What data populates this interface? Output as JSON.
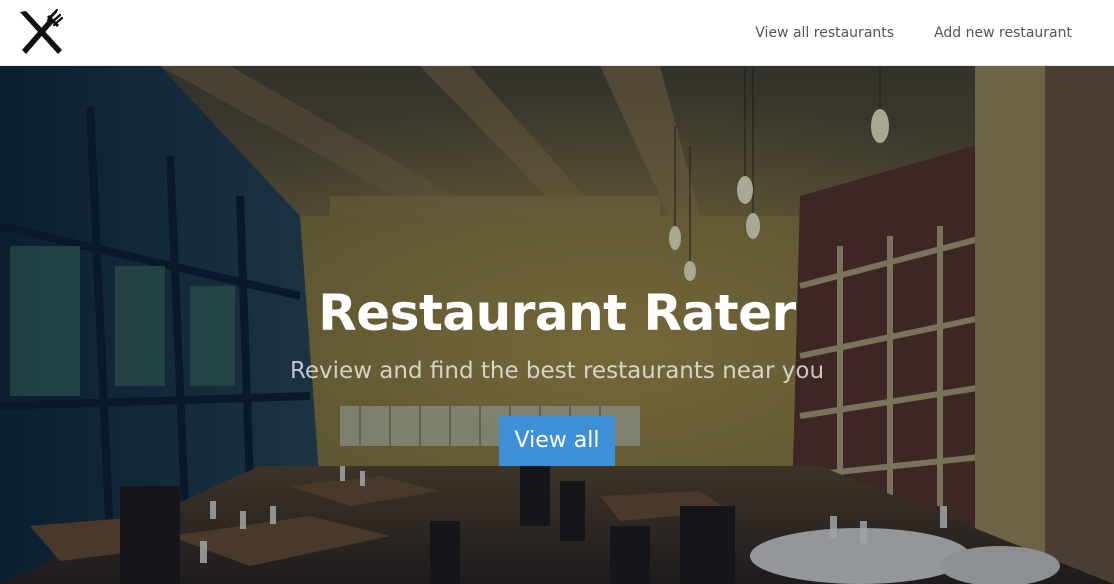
{
  "navbar": {
    "logo_icon": "fork-and-knife-icon",
    "links": [
      {
        "label": "View all restaurants"
      },
      {
        "label": "Add new restaurant"
      }
    ]
  },
  "hero": {
    "background": "restaurant-interior-photo",
    "title": "Restaurant Rater",
    "subtitle": "Review and find the best restaurants near you",
    "button_label": "View all",
    "button_color": "#3d8fd8"
  }
}
